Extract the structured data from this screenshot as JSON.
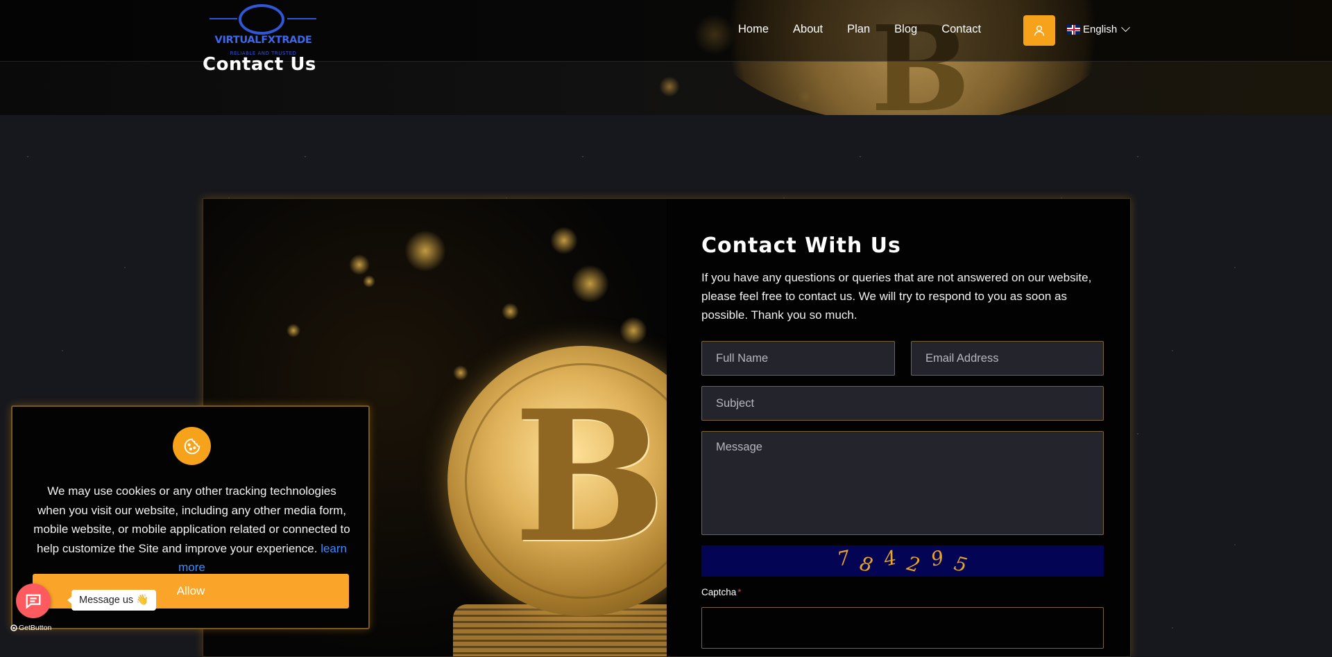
{
  "header": {
    "logo": {
      "brand": "VIRTUALFXTRADE",
      "tagline": "RELIABLE AND TRUSTED"
    },
    "nav": [
      {
        "label": "Home"
      },
      {
        "label": "About"
      },
      {
        "label": "Plan"
      },
      {
        "label": "Blog"
      },
      {
        "label": "Contact"
      }
    ],
    "user_icon": "user-icon",
    "language": {
      "label": "English",
      "flag": "uk-flag-icon"
    }
  },
  "hero": {
    "title": "Contact Us"
  },
  "contact": {
    "title": "Contact With Us",
    "description": "If you have any questions or queries that are not answered on our website, please feel free to contact us. We will try to respond to you as soon as possible. Thank you so much.",
    "fields": {
      "full_name": {
        "placeholder": "Full Name",
        "value": ""
      },
      "email": {
        "placeholder": "Email Address",
        "value": ""
      },
      "subject": {
        "placeholder": "Subject",
        "value": ""
      },
      "message": {
        "placeholder": "Message",
        "value": ""
      },
      "captcha": {
        "label": "Captcha",
        "required_mark": "*",
        "value": ""
      }
    },
    "captcha_code": [
      "7",
      "8",
      "4",
      "2",
      "9",
      "5"
    ]
  },
  "cookie_banner": {
    "icon": "cookie-icon",
    "text": "We may use cookies or any other tracking technologies when you visit our website, including any other media form, mobile website, or mobile application related or connected to help customize the Site and improve your experience.",
    "link_text": "learn more",
    "button_label": "Allow"
  },
  "chat_widget": {
    "bubble_text": "Message us 👋",
    "brand": "GetButton"
  },
  "colors": {
    "accent": "#f7a21b",
    "allow_button": "#fba42a",
    "captcha_bg": "#040455",
    "chat_button": "#ff5a5f",
    "link": "#3d8bff"
  }
}
